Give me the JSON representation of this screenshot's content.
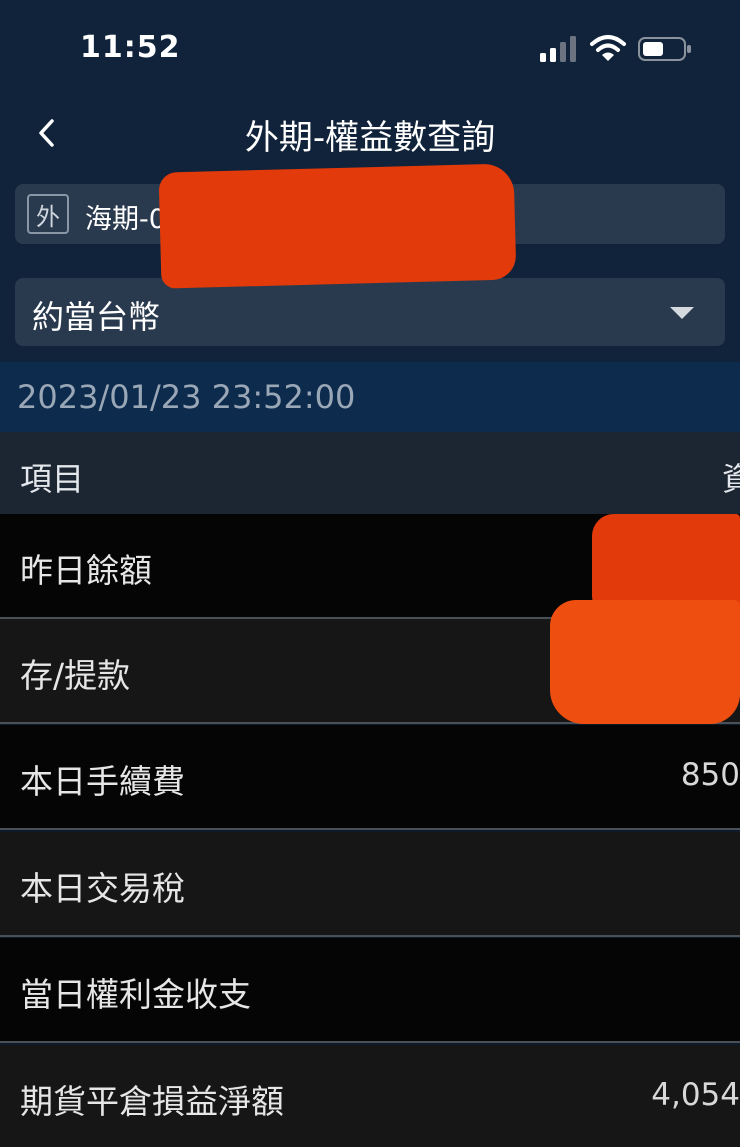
{
  "status_bar": {
    "time": "11:52"
  },
  "nav": {
    "title": "外期-權益數查詢"
  },
  "account": {
    "badge": "外",
    "text": "海期-0"
  },
  "currency": {
    "selected": "約當台幣"
  },
  "timestamp": "2023/01/23 23:52:00",
  "table": {
    "header_item": "項目",
    "header_value": "資",
    "rows": [
      {
        "label": "昨日餘額",
        "value": ""
      },
      {
        "label": "存/提款",
        "value": ""
      },
      {
        "label": "本日手續費",
        "value": "850"
      },
      {
        "label": "本日交易稅",
        "value": ""
      },
      {
        "label": "當日權利金收支",
        "value": ""
      },
      {
        "label": "期貨平倉損益淨額",
        "value": "4,054"
      }
    ]
  },
  "colors": {
    "header_bg": "#10233a",
    "timestamp_bg": "#0c2b4d",
    "field_bg": "#2a3a4e",
    "redaction": "#e23a0a"
  }
}
